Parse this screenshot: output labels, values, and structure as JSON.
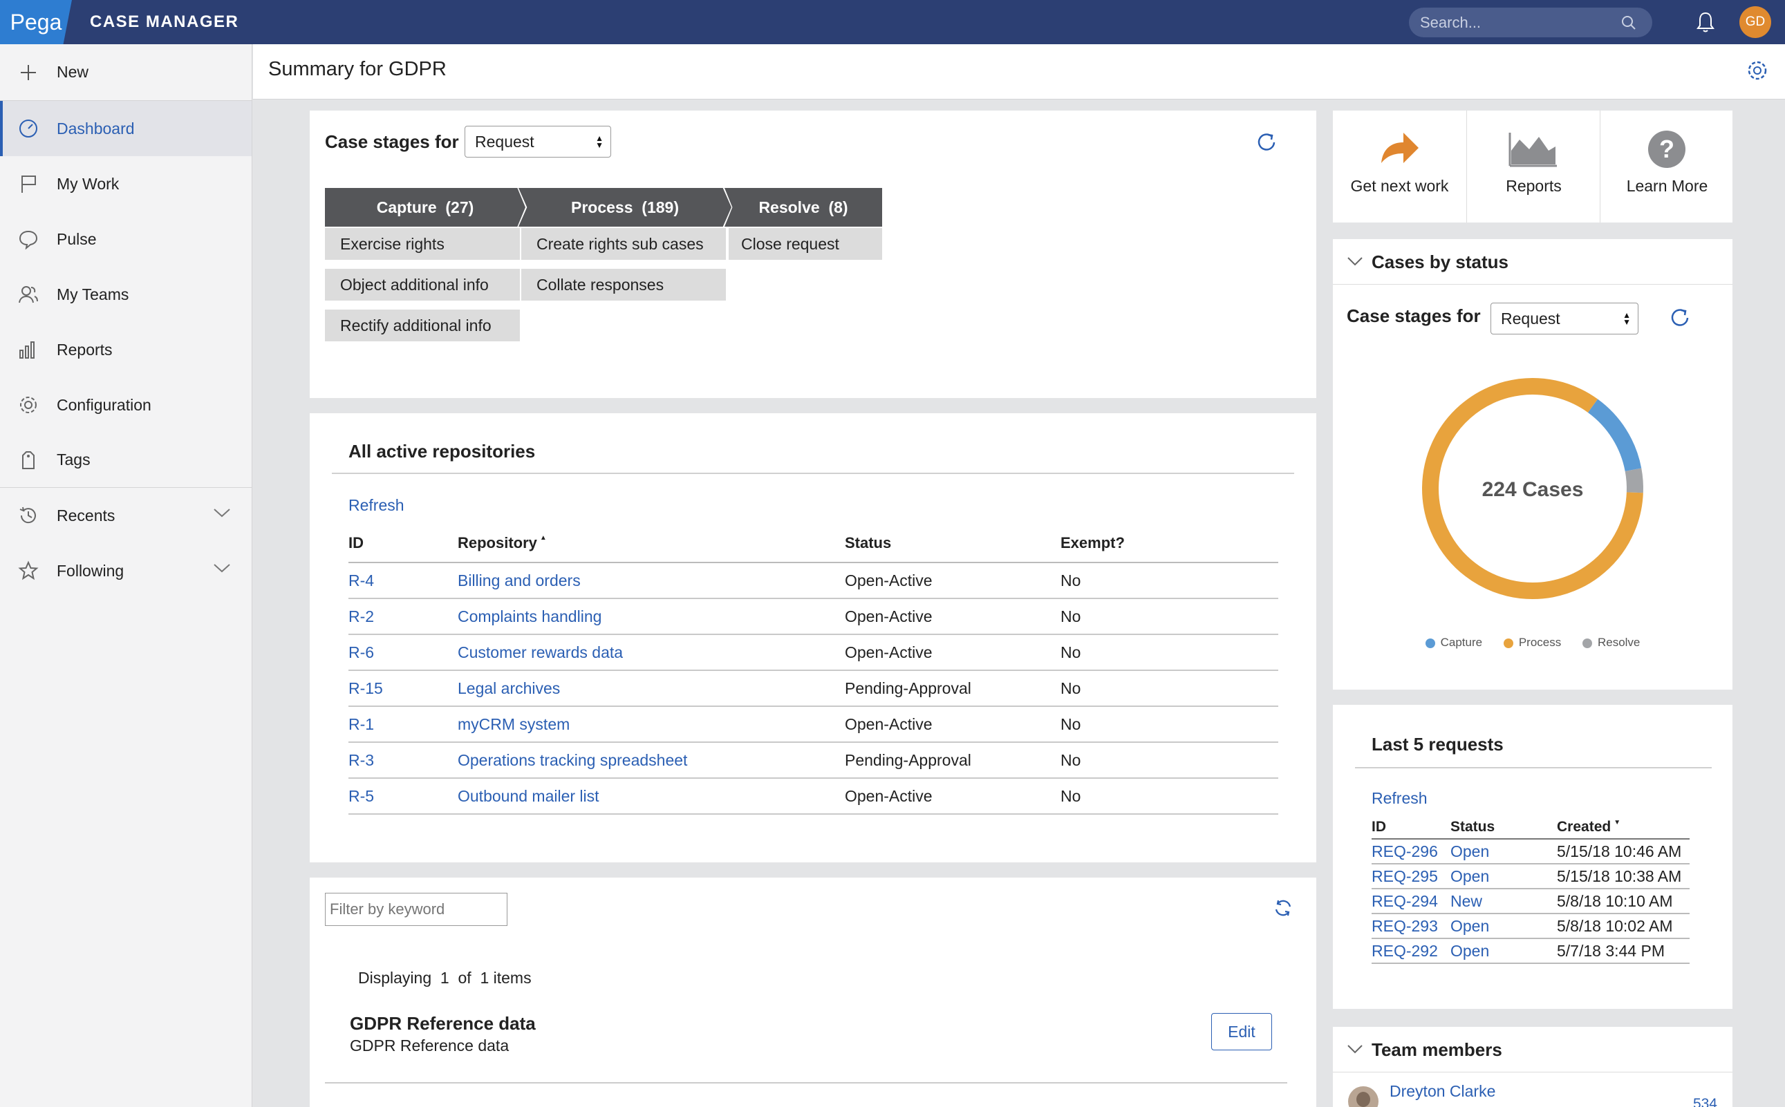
{
  "topbar": {
    "logo": "Pega",
    "app_title": "CASE MANAGER",
    "search_placeholder": "Search...",
    "avatar_initials": "GD"
  },
  "sidebar": {
    "new_label": "New",
    "items": [
      {
        "label": "Dashboard",
        "icon": "dashboard-icon"
      },
      {
        "label": "My Work",
        "icon": "flag-icon"
      },
      {
        "label": "Pulse",
        "icon": "speech-bubble-icon"
      },
      {
        "label": "My Teams",
        "icon": "team-icon"
      },
      {
        "label": "Reports",
        "icon": "bar-chart-icon"
      },
      {
        "label": "Configuration",
        "icon": "gear-icon"
      },
      {
        "label": "Tags",
        "icon": "tag-icon"
      },
      {
        "label": "Recents",
        "icon": "history-icon"
      },
      {
        "label": "Following",
        "icon": "star-icon"
      }
    ]
  },
  "header": {
    "title": "Summary for GDPR"
  },
  "stages_panel": {
    "label": "Case stages for",
    "select_value": "Request",
    "stages": [
      {
        "name": "Capture",
        "count": "(27)",
        "steps": [
          "Exercise rights",
          "Object additional info",
          "Rectify additional info"
        ]
      },
      {
        "name": "Process",
        "count": "(189)",
        "steps": [
          "Create rights sub cases",
          "Collate responses"
        ]
      },
      {
        "name": "Resolve",
        "count": "(8)",
        "steps": [
          "Close request"
        ]
      }
    ]
  },
  "repositories": {
    "title": "All active repositories",
    "refresh_label": "Refresh",
    "columns": [
      "ID",
      "Repository",
      "Status",
      "Exempt?"
    ],
    "sort_indicator": "▲",
    "rows": [
      {
        "id": "R-4",
        "repository": "Billing and orders",
        "status": "Open-Active",
        "exempt": "No"
      },
      {
        "id": "R-2",
        "repository": "Complaints handling",
        "status": "Open-Active",
        "exempt": "No"
      },
      {
        "id": "R-6",
        "repository": "Customer rewards data",
        "status": "Open-Active",
        "exempt": "No"
      },
      {
        "id": "R-15",
        "repository": "Legal archives",
        "status": "Pending-Approval",
        "exempt": "No"
      },
      {
        "id": "R-1",
        "repository": "myCRM system",
        "status": "Open-Active",
        "exempt": "No"
      },
      {
        "id": "R-3",
        "repository": "Operations tracking spreadsheet",
        "status": "Pending-Approval",
        "exempt": "No"
      },
      {
        "id": "R-5",
        "repository": "Outbound mailer list",
        "status": "Open-Active",
        "exempt": "No"
      }
    ]
  },
  "reference": {
    "filter_placeholder": "Filter by keyword",
    "displaying": "Displaying",
    "page_from": "1",
    "of_label": "of",
    "page_total": "1",
    "items_label": "items",
    "item_title": "GDPR Reference data",
    "item_subtitle": "GDPR Reference data",
    "edit_label": "Edit"
  },
  "quick_actions": [
    {
      "label": "Get next work",
      "icon": "forward-arrow-icon"
    },
    {
      "label": "Reports",
      "icon": "area-chart-icon"
    },
    {
      "label": "Learn More",
      "icon": "question-icon"
    }
  ],
  "cases_by_status": {
    "title": "Cases by status",
    "label": "Case stages for",
    "select_value": "Request",
    "center_label": "224 Cases",
    "legend": [
      "Capture",
      "Process",
      "Resolve"
    ],
    "colors": {
      "Capture": "#5b9bd5",
      "Process": "#e8a33d",
      "Resolve": "#a3a5a8"
    }
  },
  "chart_data": {
    "type": "pie",
    "categories": [
      "Capture",
      "Process",
      "Resolve"
    ],
    "values": [
      27,
      189,
      8
    ],
    "title": "224 Cases"
  },
  "last_requests": {
    "title": "Last 5 requests",
    "refresh_label": "Refresh",
    "columns": [
      "ID",
      "Status",
      "Created"
    ],
    "sort_indicator": "▼",
    "rows": [
      {
        "id": "REQ-296",
        "status": "Open",
        "created": "5/15/18 10:46 AM"
      },
      {
        "id": "REQ-295",
        "status": "Open",
        "created": "5/15/18 10:38 AM"
      },
      {
        "id": "REQ-294",
        "status": "New",
        "created": "5/8/18 10:10 AM"
      },
      {
        "id": "REQ-293",
        "status": "Open",
        "created": "5/8/18 10:02 AM"
      },
      {
        "id": "REQ-292",
        "status": "Open",
        "created": "5/7/18 3:44 PM"
      }
    ]
  },
  "team_members": {
    "title": "Team members",
    "members": [
      {
        "name": "Dreyton Clarke",
        "count": "534"
      }
    ]
  }
}
